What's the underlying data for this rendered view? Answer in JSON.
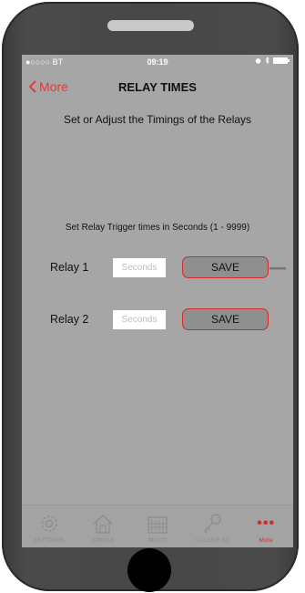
{
  "status": {
    "carrier": "●○○○○ BT",
    "time": "09:19"
  },
  "nav": {
    "back_label": "More",
    "title": "RELAY TIMES"
  },
  "subtitle": "Set or Adjust the Timings of the Relays",
  "instruction": "Set Relay Trigger times in Seconds (1 -  9999)",
  "relays": [
    {
      "label": "Relay 1",
      "placeholder": "Seconds",
      "save_label": "SAVE"
    },
    {
      "label": "Relay 2",
      "placeholder": "Seconds",
      "save_label": "SAVE"
    }
  ],
  "tabs": [
    {
      "label": "SETTINGS",
      "icon": "gear-icon"
    },
    {
      "label": "SINGLE",
      "icon": "house-icon"
    },
    {
      "label": "MULTI",
      "icon": "building-icon"
    },
    {
      "label": "CALLER ID",
      "icon": "key-icon"
    },
    {
      "label": "More",
      "icon": "more-dots-icon",
      "active": true
    }
  ],
  "colors": {
    "accent": "#d42a2a",
    "screen_bg": "#a6a6a6",
    "bezel": "#474747"
  }
}
